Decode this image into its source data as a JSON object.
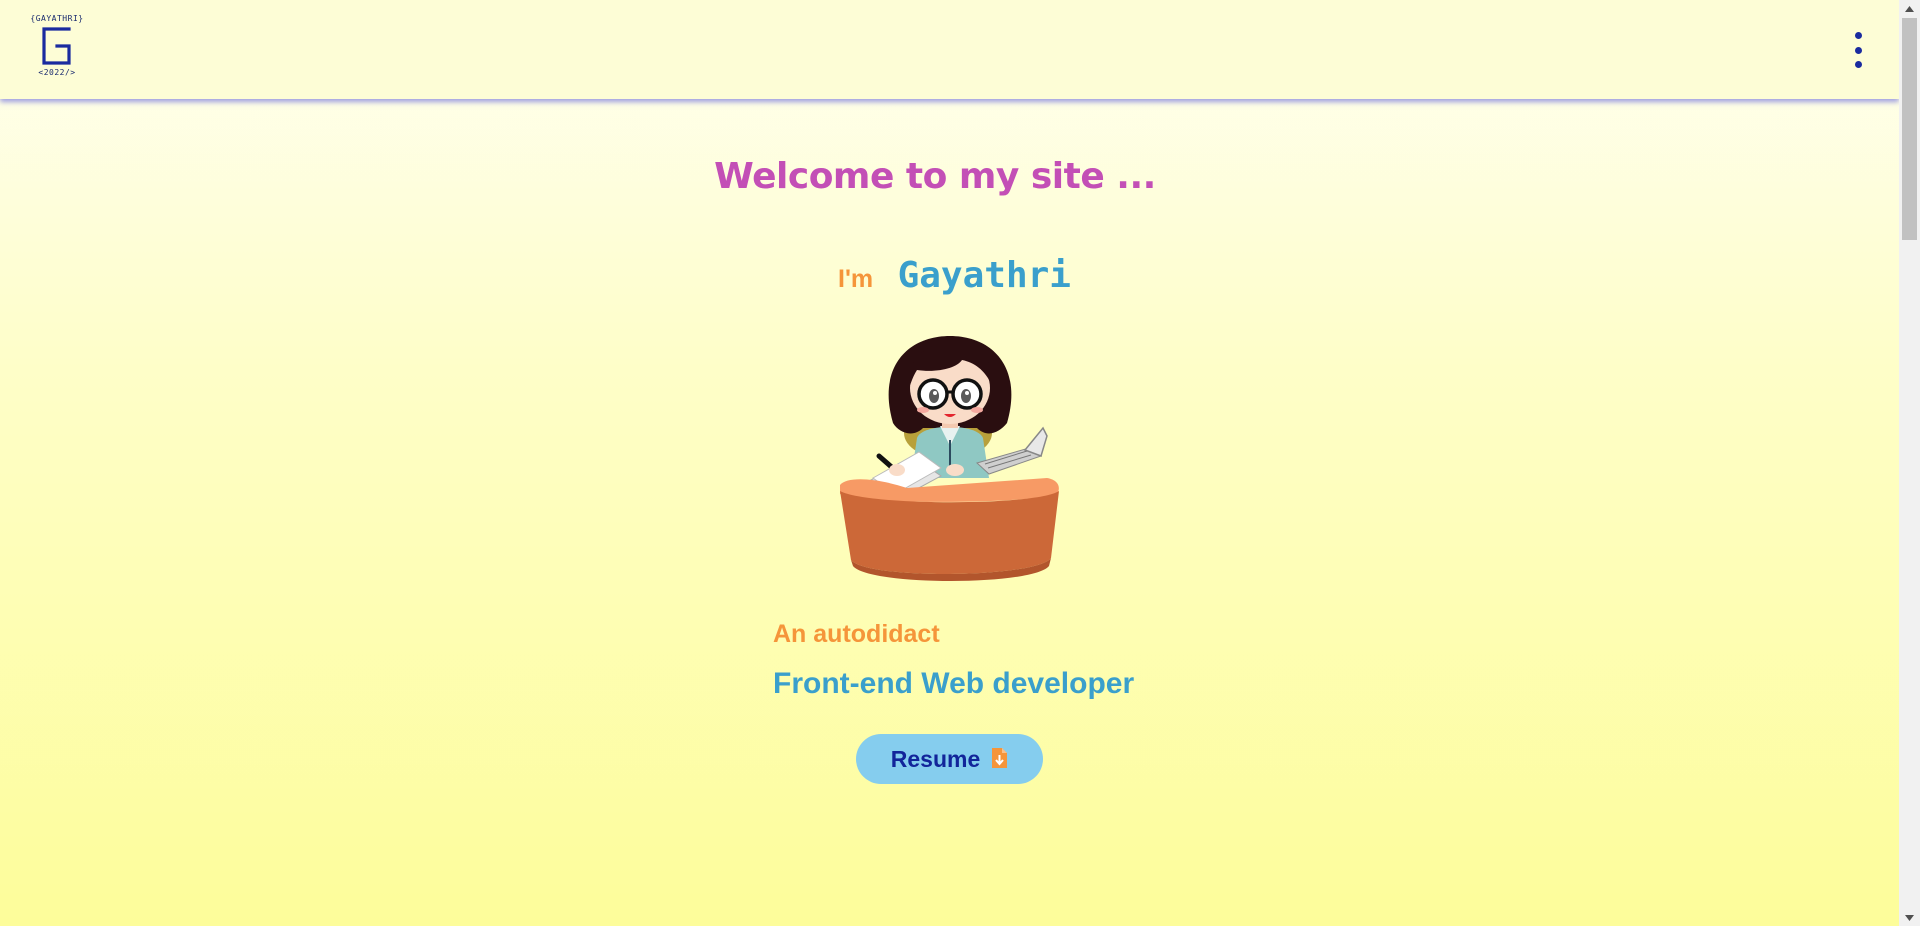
{
  "header": {
    "logo": {
      "top_text": "{GAYATHRI}",
      "bottom_text": "<2022/>",
      "mark_icon": "letter-g-logo"
    },
    "menu_icon": "vertical-dots-icon"
  },
  "hero": {
    "welcome": "Welcome to my site ...",
    "im_label": "I'm",
    "name": "Gayathri",
    "illustration_icon": "developer-at-desk-illustration",
    "tagline_primary": "An autodidact",
    "tagline_secondary": "Front-end Web developer",
    "resume_button": {
      "label": "Resume",
      "icon": "file-download-icon"
    }
  },
  "colors": {
    "header_bg": "#fdfdd6",
    "accent_blue": "#3a9fcc",
    "accent_orange": "#f5953a",
    "accent_pink": "#c34fb6",
    "button_bg": "#85cdee",
    "navy": "#12259a"
  }
}
